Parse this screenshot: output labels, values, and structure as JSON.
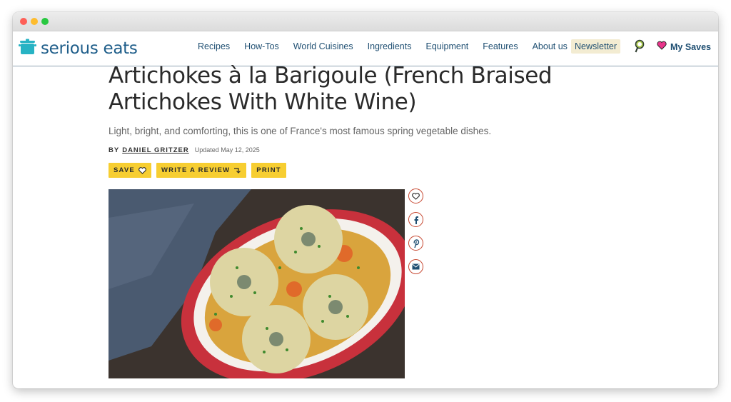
{
  "site": {
    "logo_text": "serious eats",
    "nav": [
      "Recipes",
      "How-Tos",
      "World Cuisines",
      "Ingredients",
      "Equipment",
      "Features",
      "About us"
    ],
    "newsletter": "Newsletter",
    "my_saves": "My Saves"
  },
  "article": {
    "title": "Artichokes à la Barigoule (French Braised Artichokes With White Wine)",
    "subtitle": "Light, bright, and comforting, this is one of France's most famous spring vegetable dishes.",
    "by_label": "BY",
    "author": "DANIEL GRITZER",
    "updated": "Updated May 12, 2025",
    "actions": {
      "save": "SAVE",
      "review": "WRITE A REVIEW",
      "print": "PRINT"
    }
  },
  "icons": {
    "logo": "pot-icon",
    "search": "search-icon",
    "saves": "heart-icon",
    "share": [
      "heart-icon",
      "facebook-icon",
      "pinterest-icon",
      "email-icon"
    ]
  },
  "colors": {
    "brand_blue": "#1f5e8a",
    "nav_text": "#1f4f72",
    "button_yellow": "#f7ce31",
    "share_red": "#c6462f",
    "newsletter_bg": "#f3ecd2"
  }
}
